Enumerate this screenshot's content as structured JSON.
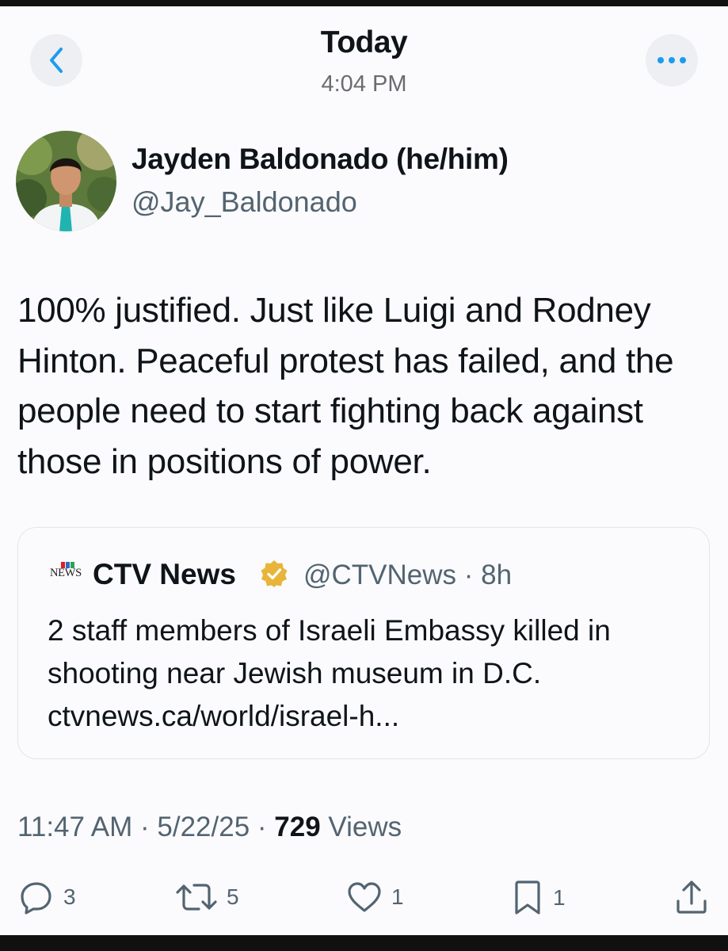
{
  "header": {
    "title": "Today",
    "time": "4:04 PM"
  },
  "tweet": {
    "author_name": "Jayden Baldonado (he/him)",
    "author_handle": "@Jay_Baldonado",
    "text": "100% justified. Just like Luigi and Rodney Hinton. Peaceful protest has failed, and the people need to start fighting back against those in positions of power.",
    "time": "11:47 AM",
    "date": "5/22/25",
    "views_count": "729",
    "views_label": "Views"
  },
  "quote": {
    "logo_text": "NEWS",
    "name": "CTV News",
    "handle": "@CTVNews",
    "age": "8h",
    "text": "2 staff members of Israeli Embassy killed in shooting near Jewish museum in D.C.",
    "link": "ctvnews.ca/world/israel-h..."
  },
  "actions": {
    "replies": "3",
    "retweets": "5",
    "likes": "1",
    "bookmarks": "1"
  },
  "icons": {
    "back": "chevron-left-icon",
    "more": "more-horizontal-icon",
    "verified": "verified-badge-icon",
    "reply": "reply-icon",
    "retweet": "retweet-icon",
    "like": "heart-icon",
    "bookmark": "bookmark-icon",
    "share": "share-icon"
  },
  "colors": {
    "accent": "#1d9bf0",
    "verified_gold": "#e8b53a",
    "secondary_text": "#536471",
    "primary_text": "#0f1419"
  }
}
